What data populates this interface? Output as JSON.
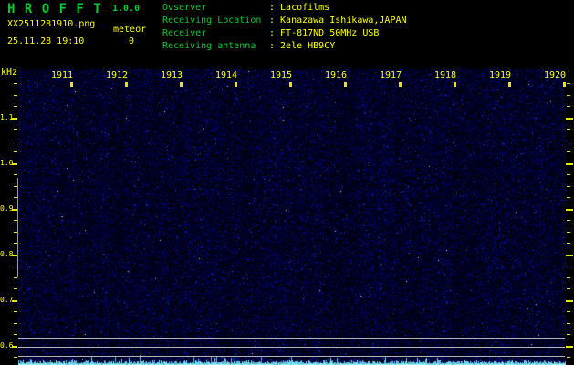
{
  "header": {
    "title": "H R O F F T",
    "version": "1.0.0",
    "filename": "XX2511281910.png",
    "mode": "meteor",
    "datetime": "25.11.28 19:10",
    "count": "0",
    "info": [
      {
        "label": "Ovserver",
        "value": ": Lacofilms"
      },
      {
        "label": "Receiving Location",
        "value": ": Kanazawa Ishikawa,JAPAN"
      },
      {
        "label": "Receiver",
        "value": ": FT-817ND 50MHz USB"
      },
      {
        "label": "Receiving antenna",
        "value": ": 2ele HB9CY"
      }
    ]
  },
  "axis": {
    "unit": "kHz",
    "freq_labels": [
      "1.1",
      "1.0",
      "0.9",
      "0.8",
      "0.7",
      "0.6"
    ],
    "time_labels": [
      "1911",
      "1912",
      "1913",
      "1914",
      "1915",
      "1916",
      "1917",
      "1918",
      "1919",
      "1920"
    ]
  },
  "colors": {
    "green": "#00cc33",
    "yellow": "#ffff00",
    "tick": "#e6e600",
    "grid_gray": "#b4b4b4",
    "baseline_cyan": "#82f0ff"
  }
}
